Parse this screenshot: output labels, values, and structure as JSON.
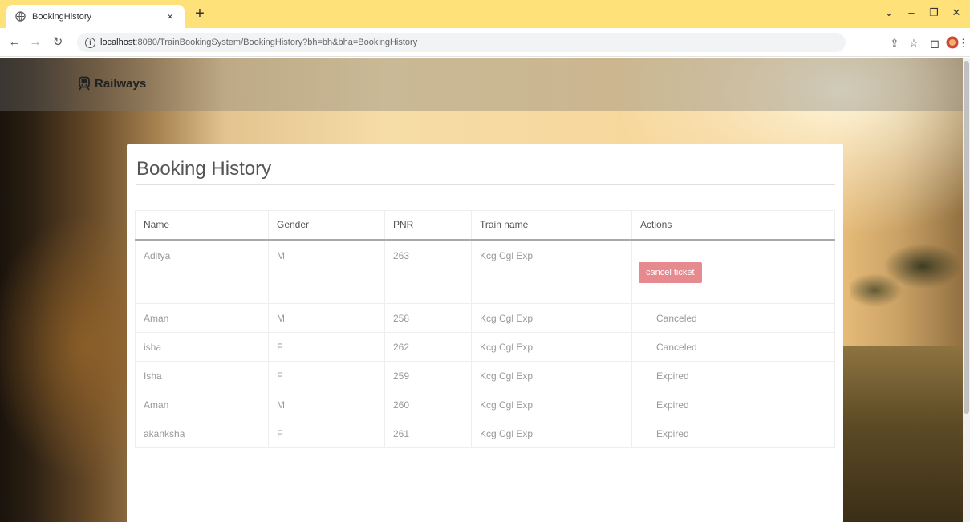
{
  "browser": {
    "tab_title": "BookingHistory",
    "tab_close": "×",
    "new_tab": "+",
    "url_host": "localhost",
    "url_path": ":8080/TrainBookingSystem/BookingHistory?bh=bh&bha=BookingHistory"
  },
  "site": {
    "brand": "Railways"
  },
  "page": {
    "title": "Booking History"
  },
  "table": {
    "headers": [
      "Name",
      "Gender",
      "PNR",
      "Train name",
      "Actions"
    ],
    "rows": [
      {
        "name": "Aditya",
        "gender": "M",
        "pnr": "263",
        "train": "Kcg Cgl Exp",
        "action": "cancel ticket"
      },
      {
        "name": "Aman",
        "gender": "M",
        "pnr": "258",
        "train": "Kcg Cgl Exp",
        "action": "Canceled"
      },
      {
        "name": "isha",
        "gender": "F",
        "pnr": "262",
        "train": "Kcg Cgl Exp",
        "action": "Canceled"
      },
      {
        "name": "Isha",
        "gender": "F",
        "pnr": "259",
        "train": "Kcg Cgl Exp",
        "action": "Expired"
      },
      {
        "name": "Aman",
        "gender": "M",
        "pnr": "260",
        "train": "Kcg Cgl Exp",
        "action": "Expired"
      },
      {
        "name": "akanksha",
        "gender": "F",
        "pnr": "261",
        "train": "Kcg Cgl Exp",
        "action": "Expired"
      }
    ]
  },
  "colors": {
    "tabbar": "#ffe17a",
    "cancel_button": "#e68a8f"
  }
}
